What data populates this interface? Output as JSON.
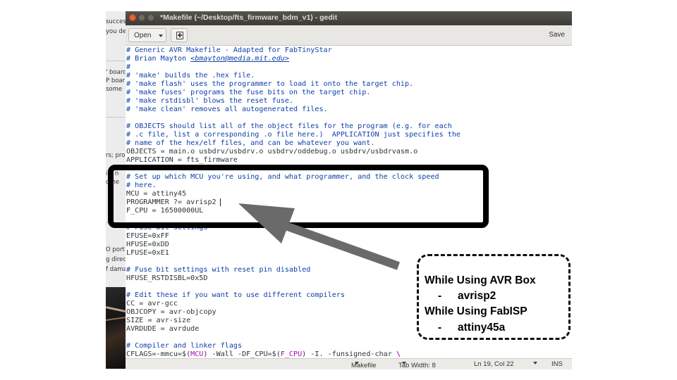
{
  "background_window": {
    "fragments": [
      "success",
      "you del",
      "' board",
      "P boar",
      "some",
      "rs; pro",
      "ist n",
      "othe",
      "O port",
      "g direc",
      "f dama"
    ]
  },
  "window": {
    "title": "*Makefile (~/Desktop/fts_firmware_bdm_v1) - gedit",
    "close_icon": "close-icon",
    "minimize_icon": "minimize-icon",
    "maximize_icon": "maximize-icon"
  },
  "toolbar": {
    "open_label": "Open",
    "new_tab_icon": "new-document-icon",
    "save_label": "Save"
  },
  "editor": {
    "lines": [
      "# Generic AVR Makefile - Adapted for FabTinyStar",
      "# Brian Mayton <bmayton@media.mit.edu>",
      "#",
      "# 'make' builds the .hex file.",
      "# 'make flash' uses the programmer to load it onto the target chip.",
      "# 'make fuses' programs the fuse bits on the target chip.",
      "# 'make rstdisbl' blows the reset fuse.",
      "# 'make clean' removes all autogenerated files.",
      "",
      "# OBJECTS should list all of the object files for the program (e.g. for each",
      "# .c file, list a corresponding .o file here.)  APPLICATION just specifies the",
      "# name of the hex/elf files, and can be whatever you want.",
      "OBJECTS = main.o usbdrv/usbdrv.o usbdrv/oddebug.o usbdrv/usbdrvasm.o",
      "APPLICATION = fts_firmware",
      "",
      "# Set up which MCU you're using, and what programmer, and the clock speed",
      "# here.",
      "MCU = attiny45",
      "PROGRAMMER ?= avrisp2",
      "F_CPU = 16500000UL",
      "",
      "# Fuse bit settings",
      "EFUSE=0xFF",
      "HFUSE=0xDD",
      "LFUSE=0xE1",
      "",
      "# Fuse bit settings with reset pin disabled",
      "HFUSE_RSTDISBL=0x5D",
      "",
      "# Edit these if you want to use different compilers",
      "CC = avr-gcc",
      "OBJCOPY = avr-objcopy",
      "SIZE = avr-size",
      "AVRDUDE = avrdude",
      "",
      "# Compiler and linker flags",
      "CFLAGS=-mmcu=$(MCU) -Wall -DF_CPU=$(F_CPU) -I. -funsigned-char \\"
    ]
  },
  "statusbar": {
    "language": "Makefile",
    "tab_width": "Tab Width: 8",
    "position": "Ln 19, Col 22",
    "mode": "INS"
  },
  "annotation": {
    "callout_lines": [
      "While Using AVR Box",
      "-",
      "avrisp2",
      "While Using FabISP",
      "-",
      "attiny45a"
    ]
  },
  "colors": {
    "comment": "#0d3fa8",
    "variable": "#a40ab8",
    "close_button": "#e9603a",
    "titlebar": "#3c3b37"
  }
}
